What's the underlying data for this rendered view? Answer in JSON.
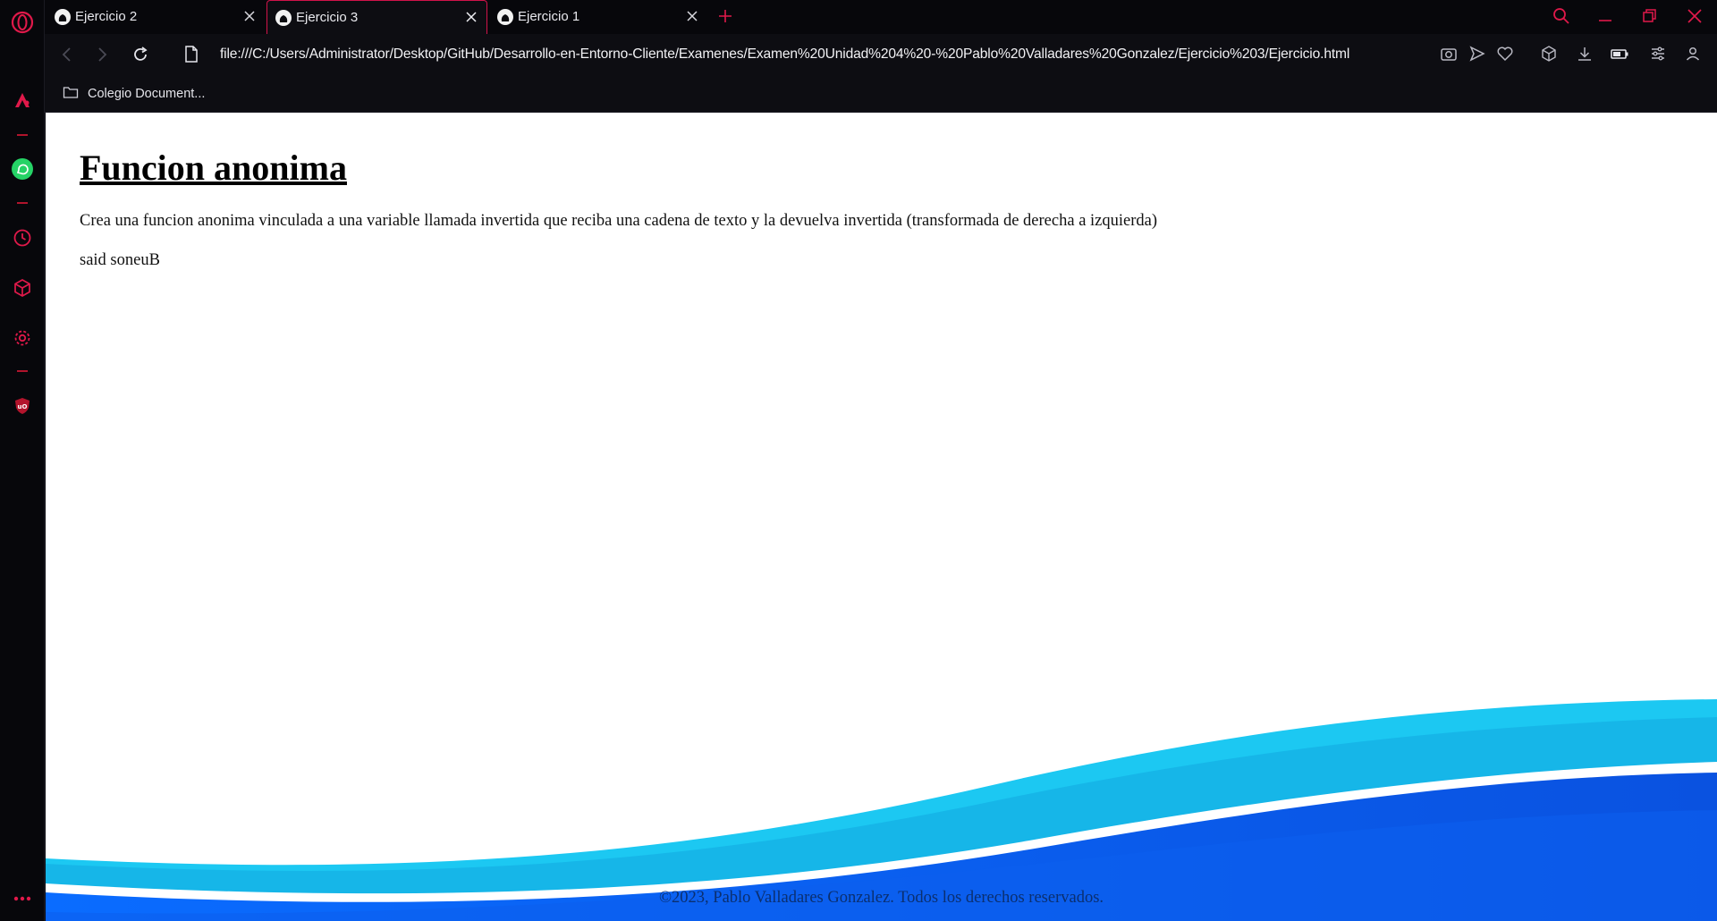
{
  "browser": {
    "tabs": [
      {
        "label": "Ejercicio 2",
        "active": false
      },
      {
        "label": "Ejercicio 3",
        "active": true
      },
      {
        "label": "Ejercicio 1",
        "active": false
      }
    ],
    "url": "file:///C:/Users/Administrator/Desktop/GitHub/Desarrollo-en-Entorno-Cliente/Examenes/Examen%20Unidad%204%20-%20Pablo%20Valladares%20Gonzalez/Ejercicio%203/Ejercicio.html",
    "bookmark": {
      "label": "Colegio Document..."
    },
    "accent_color": "#e0194a"
  },
  "page": {
    "heading": "Funcion anonima",
    "description": "Crea una funcion anonima vinculada a una variable llamada invertida que reciba una cadena de texto y la devuelva invertida (transformada de derecha a izquierda)",
    "output": "said soneuB",
    "footer": "©2023, Pablo Valladares Gonzalez. Todos los derechos reservados."
  }
}
